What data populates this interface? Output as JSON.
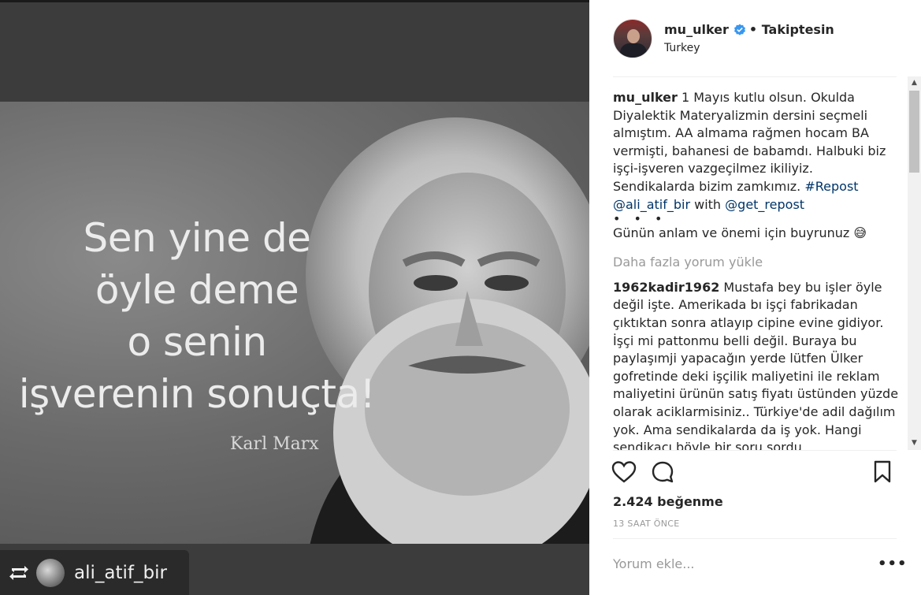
{
  "post_image": {
    "quote_lines": [
      "Sen yine de",
      "öyle deme",
      "o senin",
      "işverenin sonuçta!"
    ],
    "signature": "Karl Marx"
  },
  "repost_badge": {
    "username": "ali_atif_bir",
    "icon": "repost-icon"
  },
  "header": {
    "username": "mu_ulker",
    "verified_icon": "verified-badge-icon",
    "follow_status": "• Takiptesin",
    "location": "Turkey"
  },
  "caption": {
    "username": "mu_ulker",
    "text": " 1 Mayıs kutlu olsun. Okulda Diyalektik Materyalizmin dersini seçmeli almıştım. AA almama rağmen hocam BA vermişti, bahanesi de babamdı. Halbuki biz işçi-işveren vazgeçilmez ikiliyiz. Sendikalarda bizim zamkımız. ",
    "hashtag": "#Repost",
    "mention1": "@ali_atif_bir",
    "with_text": " with ",
    "mention2": "@get_repost",
    "dots": "• • •",
    "extra": "Günün anlam ve önemi için buyrunuz 😅"
  },
  "load_more": "Daha fazla yorum yükle",
  "comment": {
    "username": "1962kadir1962",
    "text": " Mustafa bey bu işler öyle değil işte. Amerikada bı işçi fabrikadan çıktıktan sonra atlayıp cipine evine gidiyor. İşçi mi pattonmu belli değil. Buraya bu paylaşımji yapacağın yerde lütfen Ülker gofretinde deki işçilik maliyetini ile reklam maliyetini ürünün satış fiyatı üstünden yüzde olarak aciklarmisiniz.. Türkiye'de adil dağılım yok. Ama sendikalarda da iş yok. Hangi sendikacı böyle bir soru sordu"
  },
  "actions": {
    "like_icon": "heart-icon",
    "comment_icon": "comment-bubble-icon",
    "save_icon": "bookmark-icon"
  },
  "likes": "2.424 beğenme",
  "timestamp": "13 SAAT ÖNCE",
  "add_comment_placeholder": "Yorum ekle...",
  "more_options": "•••"
}
